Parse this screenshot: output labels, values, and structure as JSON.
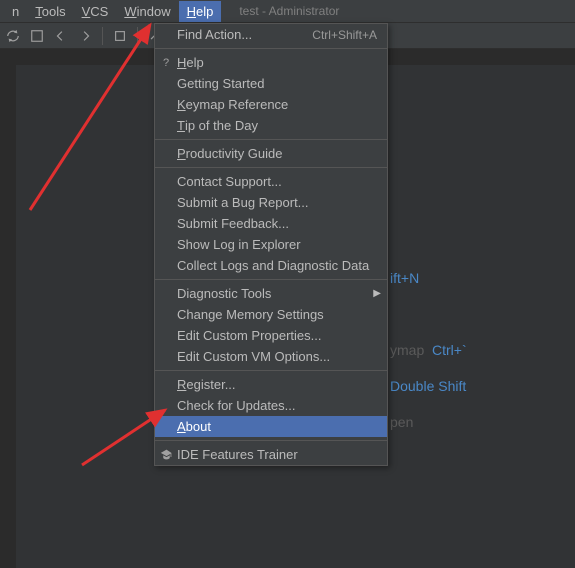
{
  "window": {
    "title": "test - Administrator"
  },
  "menubar": {
    "items": [
      {
        "label": "n",
        "mn": ""
      },
      {
        "label": "ools",
        "mn": "T"
      },
      {
        "label": "CS",
        "mn": "V"
      },
      {
        "label": "indow",
        "mn": "W"
      },
      {
        "label": "elp",
        "mn": "H"
      }
    ],
    "active_index": 4
  },
  "toolbar_icons": [
    "sync-icon",
    "nav-back-icon",
    "nav-fwd-icon",
    "divider",
    "wrench-icon"
  ],
  "help_menu": {
    "groups": [
      [
        {
          "label": "Find Action...",
          "shortcut": "Ctrl+Shift+A",
          "icon": ""
        }
      ],
      [
        {
          "label": "elp",
          "mn": "H",
          "icon": "?"
        },
        {
          "label": "Getting Started"
        },
        {
          "label": "eymap Reference",
          "mn": "K"
        },
        {
          "label": "ip of the Day",
          "mn": "T"
        }
      ],
      [
        {
          "label": "roductivity Guide",
          "mn": "P"
        }
      ],
      [
        {
          "label": "Contact Support..."
        },
        {
          "label": "Submit a Bug Report..."
        },
        {
          "label": "Submit Feedback..."
        },
        {
          "label": "Show Log in Explorer"
        },
        {
          "label": "Collect Logs and Diagnostic Data"
        }
      ],
      [
        {
          "label": "Diagnostic Tools",
          "submenu": true
        },
        {
          "label": "Change Memory Settings"
        },
        {
          "label": "Edit Custom Properties..."
        },
        {
          "label": "Edit Custom VM Options..."
        }
      ],
      [
        {
          "label": "egister...",
          "mn": "R"
        },
        {
          "label": "Check for Updates..."
        },
        {
          "label": "bout",
          "mn": "A",
          "selected": true
        }
      ],
      [
        {
          "label": "IDE Features Trainer",
          "icon": "cap"
        }
      ]
    ]
  },
  "bg_hints": [
    {
      "suffix": "ift+N"
    },
    {
      "suffix": ""
    },
    {
      "suffix_label": "ymap",
      "kb": "Ctrl+`"
    },
    {
      "kb": "Double Shift"
    },
    {
      "suffix_label": "pen"
    }
  ]
}
